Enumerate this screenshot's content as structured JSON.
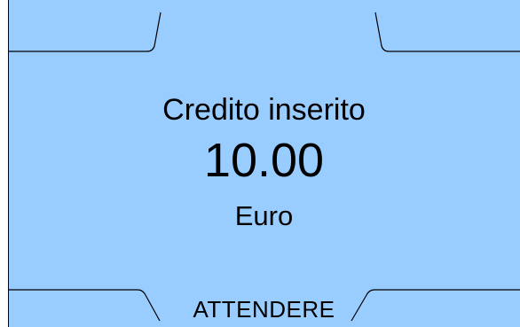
{
  "screen": {
    "title": "Credito inserito",
    "amount": "10.00",
    "currency": "Euro",
    "status": "ATTENDERE"
  },
  "colors": {
    "background": "#99ccff",
    "frame": "#000000",
    "text": "#000000"
  }
}
